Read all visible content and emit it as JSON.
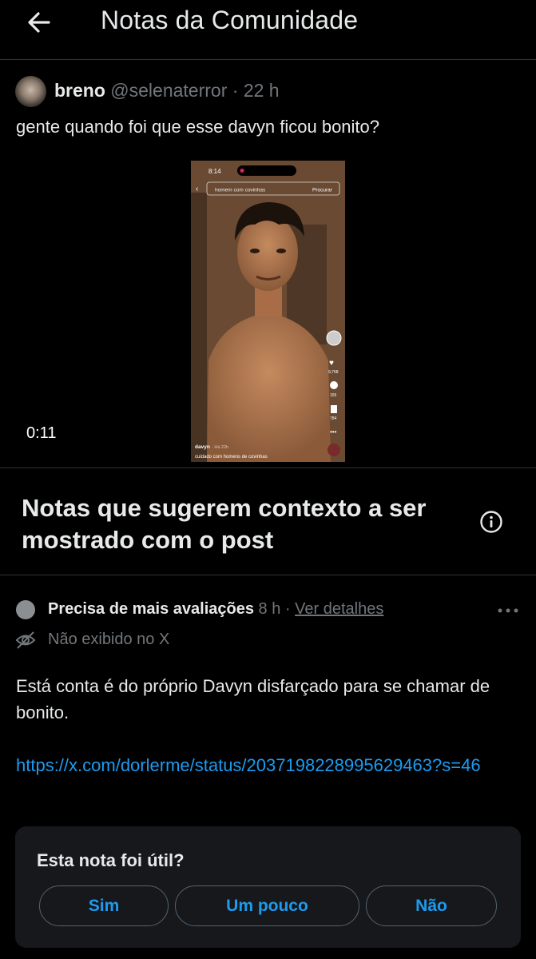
{
  "header": {
    "title": "Notas da Comunidade",
    "back_icon": "arrow-left-icon"
  },
  "post": {
    "author_name": "breno",
    "author_handle": "@selenaterror",
    "separator": "·",
    "time": "22 h",
    "text": "gente quando foi que esse davyn ficou bonito?",
    "video_duration": "0:11",
    "screenshot": {
      "clock": "8:14",
      "search_text": "homem com covinhas",
      "search_button": "Procurar",
      "likes": "9,768",
      "comments": "155",
      "saves": "784",
      "username": "davyn",
      "posted": "· Há 22h",
      "caption": "cuidado com homens de covinhas"
    }
  },
  "notes_section": {
    "title": "Notas que sugerem contexto a ser mostrado com o post",
    "info_icon": "info-icon"
  },
  "note": {
    "status": "Precisa de mais avaliações",
    "time": "8 h",
    "separator": "·",
    "details_link": "Ver detalhes",
    "visibility": "Não exibido no X",
    "text": "Está conta é do próprio Davyn disfarçado para se chamar de bonito.",
    "link": "https://x.com/dorlerme/status/2037198228995629463?s=46"
  },
  "rating": {
    "question": "Esta nota foi útil?",
    "options": [
      "Sim",
      "Um pouco",
      "Não"
    ]
  },
  "colors": {
    "accent": "#1d9bf0",
    "muted": "#71767b",
    "background": "#000000",
    "card": "#16181c"
  }
}
